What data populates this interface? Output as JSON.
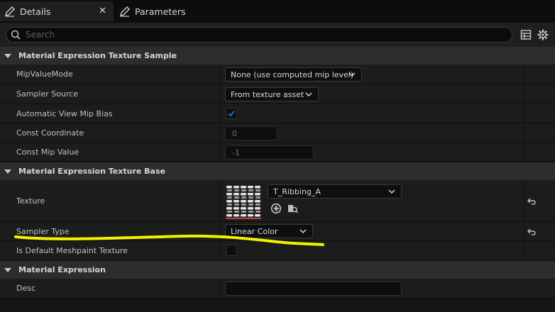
{
  "tabs": [
    {
      "label": "Details",
      "icon": "pencil-icon",
      "close": "✕"
    },
    {
      "label": "Parameters",
      "icon": "pencil-icon"
    }
  ],
  "search": {
    "placeholder": "Search"
  },
  "sections": {
    "texture_sample": {
      "title": "Material Expression Texture Sample",
      "mip_value_mode": {
        "label": "MipValueMode",
        "value": "None (use computed mip level)"
      },
      "sampler_source": {
        "label": "Sampler Source",
        "value": "From texture asset"
      },
      "auto_view_mip_bias": {
        "label": "Automatic View Mip Bias",
        "checked": true
      },
      "const_coordinate": {
        "label": "Const Coordinate",
        "value": "0"
      },
      "const_mip_value": {
        "label": "Const Mip Value",
        "value": "-1"
      }
    },
    "texture_base": {
      "title": "Material Expression Texture Base",
      "texture": {
        "label": "Texture",
        "value": "T_Ribbing_A"
      },
      "sampler_type": {
        "label": "Sampler Type",
        "value": "Linear Color"
      },
      "is_default_meshpaint": {
        "label": "Is Default Meshpaint Texture",
        "checked": false
      }
    },
    "expression": {
      "title": "Material Expression",
      "desc": {
        "label": "Desc",
        "value": ""
      }
    }
  },
  "colors": {
    "background": "#151515",
    "row": "#1c1c1c",
    "section_header": "#2d2d2d",
    "checkbox_accent": "#1f74d6",
    "annotation_highlight": "#f2f200",
    "texture_underline": "#c24040"
  }
}
